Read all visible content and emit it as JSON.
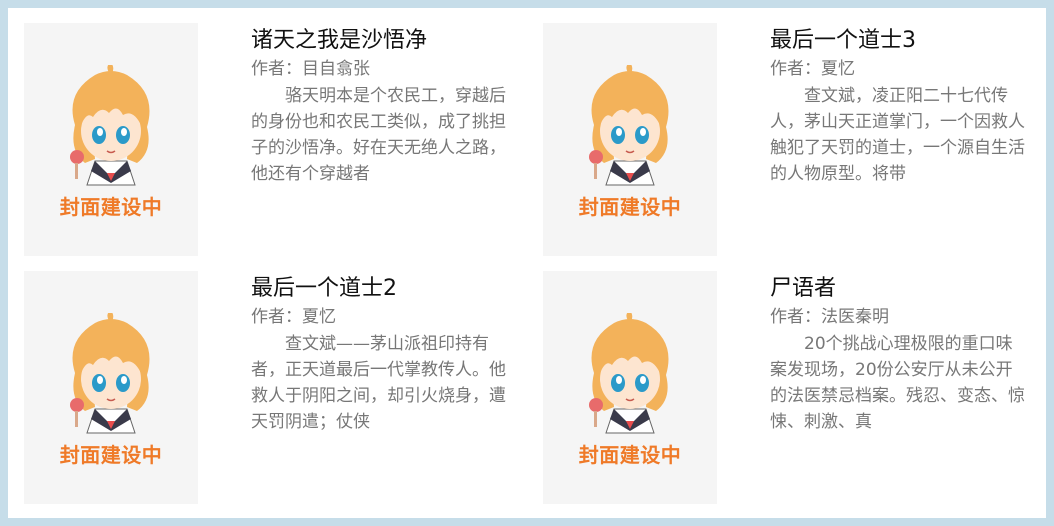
{
  "cover_placeholder": "封面建设中",
  "colors": {
    "border": "#c6dde9",
    "cover_bg": "#f5f5f5",
    "cover_label": "#ef7a28"
  },
  "books": [
    {
      "title": "诸天之我是沙悟净",
      "author": "作者：目自翕张",
      "desc": "骆天明本是个农民工，穿越后的身份也和农民工类似，成了挑担子的沙悟净。好在天无绝人之路，他还有个穿越者"
    },
    {
      "title": "最后一个道士3",
      "author": "作者：夏忆",
      "desc": "查文斌，凌正阳二十七代传人，茅山天正道掌门，一个因救人触犯了天罚的道士，一个源自生活的人物原型。将带"
    },
    {
      "title": "最后一个道士2",
      "author": "作者：夏忆",
      "desc": "查文斌——茅山派祖印持有者，正天道最后一代掌教传人。他救人于阴阳之间，却引火烧身，遭天罚阴遣；仗侠"
    },
    {
      "title": "尸语者",
      "author": "作者：法医秦明",
      "desc": "20个挑战心理极限的重口味案发现场，20份公安厅从未公开的法医禁忌档案。残忍、变态、惊悚、刺激、真"
    }
  ]
}
